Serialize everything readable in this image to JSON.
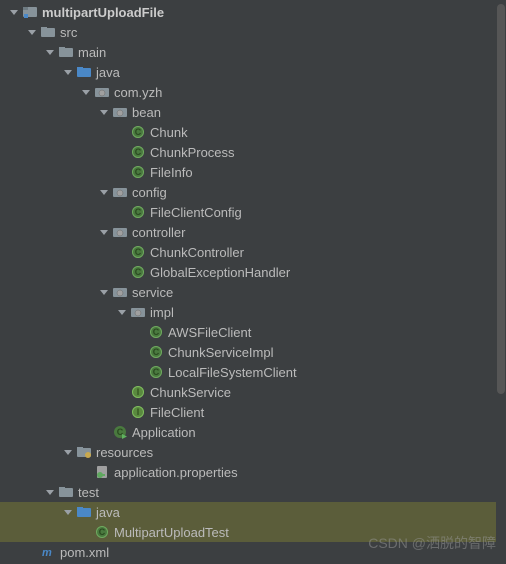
{
  "tree": [
    {
      "depth": 0,
      "arrow": "down",
      "icon": "module",
      "label": "multipartUploadFile",
      "bold": true
    },
    {
      "depth": 1,
      "arrow": "down",
      "icon": "folder",
      "label": "src"
    },
    {
      "depth": 2,
      "arrow": "down",
      "icon": "folder",
      "label": "main"
    },
    {
      "depth": 3,
      "arrow": "down",
      "icon": "folder-src",
      "label": "java"
    },
    {
      "depth": 4,
      "arrow": "down",
      "icon": "package",
      "label": "com.yzh"
    },
    {
      "depth": 5,
      "arrow": "down",
      "icon": "package",
      "label": "bean"
    },
    {
      "depth": 6,
      "arrow": "none",
      "icon": "class",
      "label": "Chunk"
    },
    {
      "depth": 6,
      "arrow": "none",
      "icon": "class",
      "label": "ChunkProcess"
    },
    {
      "depth": 6,
      "arrow": "none",
      "icon": "class",
      "label": "FileInfo"
    },
    {
      "depth": 5,
      "arrow": "down",
      "icon": "package",
      "label": "config"
    },
    {
      "depth": 6,
      "arrow": "none",
      "icon": "class",
      "label": "FileClientConfig"
    },
    {
      "depth": 5,
      "arrow": "down",
      "icon": "package",
      "label": "controller"
    },
    {
      "depth": 6,
      "arrow": "none",
      "icon": "class",
      "label": "ChunkController"
    },
    {
      "depth": 6,
      "arrow": "none",
      "icon": "class",
      "label": "GlobalExceptionHandler"
    },
    {
      "depth": 5,
      "arrow": "down",
      "icon": "package",
      "label": "service"
    },
    {
      "depth": 6,
      "arrow": "down",
      "icon": "package",
      "label": "impl"
    },
    {
      "depth": 7,
      "arrow": "none",
      "icon": "class",
      "label": "AWSFileClient"
    },
    {
      "depth": 7,
      "arrow": "none",
      "icon": "class",
      "label": "ChunkServiceImpl"
    },
    {
      "depth": 7,
      "arrow": "none",
      "icon": "class",
      "label": "LocalFileSystemClient"
    },
    {
      "depth": 6,
      "arrow": "none",
      "icon": "interface",
      "label": "ChunkService"
    },
    {
      "depth": 6,
      "arrow": "none",
      "icon": "interface",
      "label": "FileClient"
    },
    {
      "depth": 5,
      "arrow": "none",
      "icon": "class-run",
      "label": "Application"
    },
    {
      "depth": 3,
      "arrow": "down",
      "icon": "folder-res",
      "label": "resources"
    },
    {
      "depth": 4,
      "arrow": "none",
      "icon": "properties",
      "label": "application.properties"
    },
    {
      "depth": 2,
      "arrow": "down",
      "icon": "folder",
      "label": "test"
    },
    {
      "depth": 3,
      "arrow": "down",
      "icon": "folder-src",
      "label": "java",
      "highlight": true
    },
    {
      "depth": 4,
      "arrow": "none",
      "icon": "class",
      "label": "MultipartUploadTest",
      "highlight": true
    },
    {
      "depth": 1,
      "arrow": "none",
      "icon": "maven",
      "label": "pom.xml"
    }
  ],
  "watermark": "CSDN @洒脱的智障"
}
